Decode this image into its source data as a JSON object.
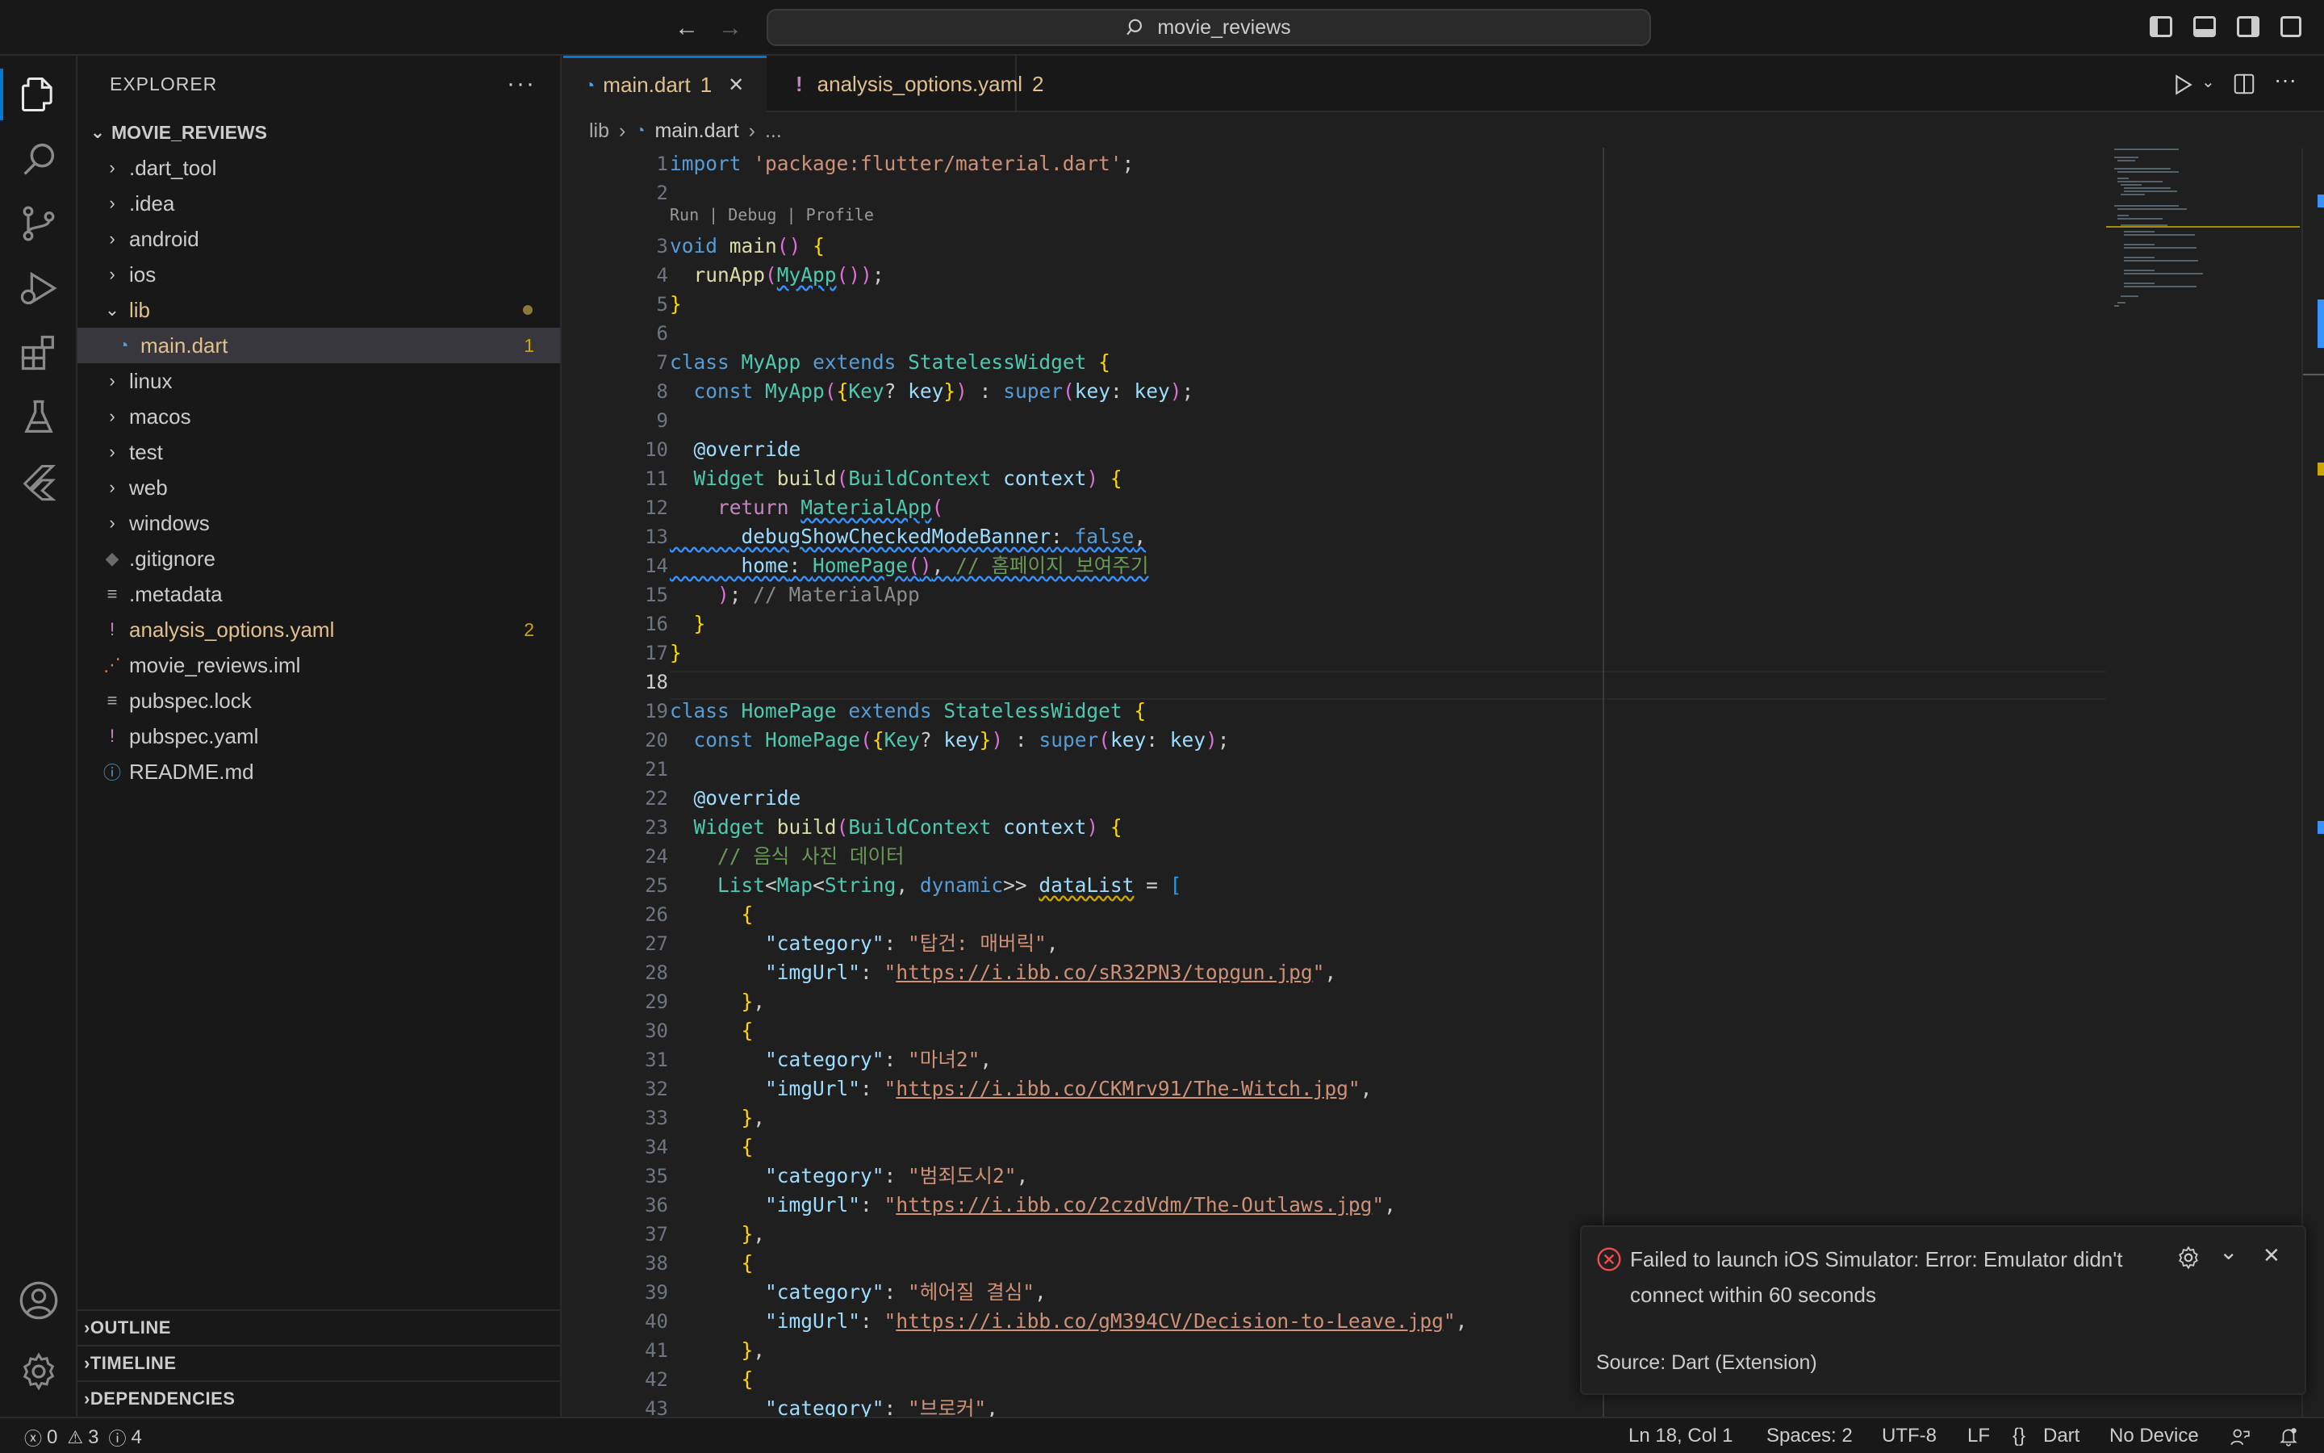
{
  "titlebar": {
    "search_text": "movie_reviews",
    "back": "←",
    "forward": "→"
  },
  "sidebar": {
    "header": "EXPLORER",
    "more": "···",
    "root": "MOVIE_REVIEWS",
    "items": [
      {
        "label": ".dart_tool",
        "type": "folder",
        "chev": "›"
      },
      {
        "label": ".idea",
        "type": "folder",
        "chev": "›"
      },
      {
        "label": "android",
        "type": "folder",
        "chev": "›"
      },
      {
        "label": "ios",
        "type": "folder",
        "chev": "›"
      },
      {
        "label": "lib",
        "type": "folder-open",
        "chev": "⌄"
      },
      {
        "label": "main.dart",
        "type": "file-dart",
        "badge": "1"
      },
      {
        "label": "linux",
        "type": "folder",
        "chev": "›"
      },
      {
        "label": "macos",
        "type": "folder",
        "chev": "›"
      },
      {
        "label": "test",
        "type": "folder",
        "chev": "›"
      },
      {
        "label": "web",
        "type": "folder",
        "chev": "›"
      },
      {
        "label": "windows",
        "type": "folder",
        "chev": "›"
      },
      {
        "label": ".gitignore",
        "type": "file"
      },
      {
        "label": ".metadata",
        "type": "file"
      },
      {
        "label": "analysis_options.yaml",
        "type": "file-warn",
        "badge": "2"
      },
      {
        "label": "movie_reviews.iml",
        "type": "file"
      },
      {
        "label": "pubspec.lock",
        "type": "file"
      },
      {
        "label": "pubspec.yaml",
        "type": "file-excl"
      },
      {
        "label": "README.md",
        "type": "file"
      }
    ],
    "sections": [
      "OUTLINE",
      "TIMELINE",
      "DEPENDENCIES"
    ]
  },
  "tabs": [
    {
      "label": "main.dart",
      "badge": "1",
      "close": "✕"
    },
    {
      "label": "analysis_options.yaml",
      "badge": "2",
      "prefix": "!"
    }
  ],
  "breadcrumb": {
    "folder": "lib",
    "file": "main.dart",
    "rest": "..."
  },
  "editor": {
    "codelens": "Run | Debug | Profile",
    "current_line": 18,
    "lines": [
      "import 'package:flutter/material.dart';",
      "",
      "void main() {",
      "  runApp(MyApp());",
      "}",
      "",
      "class MyApp extends StatelessWidget {",
      "  const MyApp({Key? key}) : super(key: key);",
      "",
      "  @override",
      "  Widget build(BuildContext context) {",
      "    return MaterialApp(",
      "      debugShowCheckedModeBanner: false,",
      "      home: HomePage(), // 홈페이지 보여주기",
      "    ); // MaterialApp",
      "  }",
      "}",
      "",
      "class HomePage extends StatelessWidget {",
      "  const HomePage({Key? key}) : super(key: key);",
      "",
      "  @override",
      "  Widget build(BuildContext context) {",
      "    // 음식 사진 데이터",
      "    List<Map<String, dynamic>> dataList = [",
      "      {",
      "        \"category\": \"탑건: 매버릭\",",
      "        \"imgUrl\": \"https://i.ibb.co/sR32PN3/topgun.jpg\",",
      "      },",
      "      {",
      "        \"category\": \"마녀2\",",
      "        \"imgUrl\": \"https://i.ibb.co/CKMrv91/The-Witch.jpg\",",
      "      },",
      "      {",
      "        \"category\": \"범죄도시2\",",
      "        \"imgUrl\": \"https://i.ibb.co/2czdVdm/The-Outlaws.jpg\",",
      "      },",
      "      {",
      "        \"category\": \"헤어질 결심\",",
      "        \"imgUrl\": \"https://i.ibb.co/gM394CV/Decision-to-Leave.jpg\",",
      "      },",
      "      {",
      "        \"category\": \"브로커\","
    ]
  },
  "notification": {
    "message": "Failed to launch iOS Simulator: Error: Emulator didn't connect within 60 seconds",
    "source": "Source: Dart (Extension)"
  },
  "statusbar": {
    "errors": "0",
    "warnings": "3",
    "infos": "4",
    "position": "Ln 18, Col 1",
    "spaces": "Spaces: 2",
    "encoding": "UTF-8",
    "eol": "LF",
    "language": "Dart",
    "language_icon": "{}",
    "device": "No Device"
  },
  "colors": {
    "accent": "#0078d4",
    "warning": "#cca700",
    "error": "#f14c4c"
  }
}
